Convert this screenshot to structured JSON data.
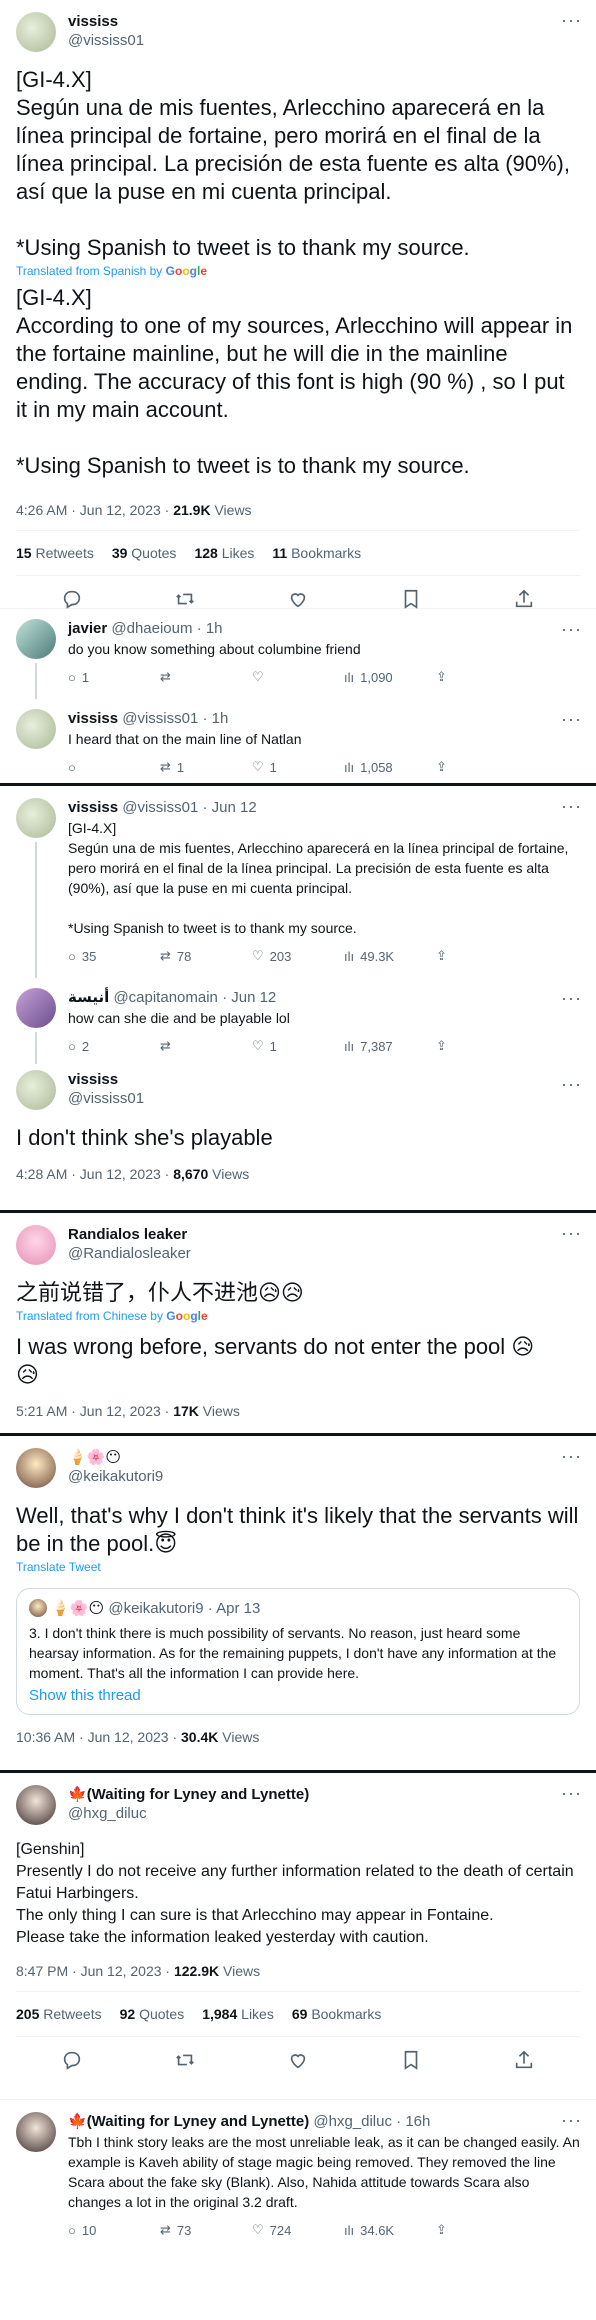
{
  "colors": {
    "accent": "#1d9bf0",
    "text": "#0f1419",
    "muted": "#536471",
    "border": "#eff3f4"
  },
  "t1": {
    "display_name": "vississ",
    "username": "@vississ01",
    "text_es": "[GI-4.X]\nSegún una de mis fuentes, Arlecchino aparecerá en la línea principal de fortaine, pero morirá en el final de la línea principal. La precisión de esta fuente es alta (90%), así que la puse en mi cuenta principal.\n\n*Using Spanish to tweet is to thank my source.",
    "translated_prefix": "Translated from Spanish by",
    "text_en": "[GI-4.X]\nAccording to one of my sources, Arlecchino will appear in the fortaine mainline, but he will die in the mainline ending. The accuracy of this font is high (90 %) , so I put it in my main account.\n\n*Using Spanish to tweet is to thank my source.",
    "time": "4:26 AM · Jun 12, 2023 ·",
    "views_num": "21.9K",
    "views_label": "Views",
    "retweets_num": "15",
    "retweets_label": "Retweets",
    "quotes_num": "39",
    "quotes_label": "Quotes",
    "likes_num": "128",
    "likes_label": "Likes",
    "bookmarks_num": "11",
    "bookmarks_label": "Bookmarks"
  },
  "r1": {
    "display_name": "javier",
    "username": "@dhaeioum",
    "time": "· 1h",
    "text": "do you know something about columbine friend",
    "replies": "1",
    "retweets": "",
    "likes": "",
    "views": "1,090"
  },
  "r2": {
    "display_name": "vississ",
    "username": "@vississ01",
    "time": "· 1h",
    "text": "I heard that on the main line of Natlan",
    "replies": "",
    "retweets": "1",
    "likes": "1",
    "views": "1,058"
  },
  "t2": {
    "display_name": "vississ",
    "username": "@vississ01",
    "time": "· Jun 12",
    "text": "[GI-4.X]\nSegún una de mis fuentes, Arlecchino aparecerá en la línea principal de fortaine, pero morirá en el final de la línea principal. La precisión de esta fuente es alta (90%), así que la puse en mi cuenta principal.\n\n*Using Spanish to tweet is to thank my source.",
    "replies": "35",
    "retweets": "78",
    "likes": "203",
    "views": "49.3K"
  },
  "t3": {
    "display_name": "أنيسة",
    "username": "@capitanomain",
    "time": "· Jun 12",
    "text": "how can she die and be playable lol",
    "replies": "2",
    "retweets": "",
    "likes": "1",
    "views": "7,387"
  },
  "t4": {
    "display_name": "vississ",
    "username": "@vississ01",
    "text": "I don't think she's playable",
    "time": "4:28 AM · Jun 12, 2023 ·",
    "views_num": "8,670",
    "views_label": "Views"
  },
  "t5": {
    "display_name": "Randialos leaker",
    "username": "@Randialosleaker",
    "text_zh": "之前说错了，仆人不进池😥😥",
    "translated_prefix": "Translated from Chinese by",
    "text_en": "I was wrong before, servants do not enter the pool 😥\n😥",
    "time": "5:21 AM · Jun 12, 2023 ·",
    "views_num": "17K",
    "views_label": "Views"
  },
  "t6": {
    "display_name": "🍦🌸😶",
    "username": "@keikakutori9",
    "text": "Well, that's why I don't think it's likely that the servants will be in the pool.😇",
    "translate": "Translate Tweet",
    "quote_name": "🍦🌸😶",
    "quote_user": "@keikakutori9 · Apr 13",
    "quote_text": "3. I don't think there is much possibility of servants. No reason, just heard some hearsay information. As for the remaining puppets, I don't have any information at the moment. That's all the information I can provide here.",
    "quote_link": "Show this thread",
    "time": "10:36 AM · Jun 12, 2023 ·",
    "views_num": "30.4K",
    "views_label": "Views"
  },
  "t7": {
    "flag": "🍁",
    "display_name": "(Waiting for Lyney and Lynette)",
    "username": "@hxg_diluc",
    "text": "[Genshin]\nPresently I do not receive any further information related to the death of certain Fatui Harbingers.\nThe only thing I can sure is that Arlecchino may appear in Fontaine.\nPlease take the information leaked yesterday with caution.",
    "time": "8:47 PM · Jun 12, 2023 ·",
    "views_num": "122.9K",
    "views_label": "Views",
    "retweets_num": "205",
    "retweets_label": "Retweets",
    "quotes_num": "92",
    "quotes_label": "Quotes",
    "likes_num": "1,984",
    "likes_label": "Likes",
    "bookmarks_num": "69",
    "bookmarks_label": "Bookmarks"
  },
  "t8": {
    "flag": "🍁",
    "display_name": "(Waiting for Lyney and Lynette)",
    "username": "@hxg_diluc",
    "time": "· 16h",
    "text": "Tbh I think story leaks are the most unreliable leak, as it can be changed easily. An example is Kaveh ability of stage magic being removed. They removed the line Scara about the fake sky (Blank). Also, Nahida attitude towards Scara also changes a lot in the original 3.2 draft.",
    "replies": "10",
    "retweets": "73",
    "likes": "724",
    "views": "34.6K"
  },
  "google": {
    "g1": "G",
    "g2": "o",
    "g3": "o",
    "g4": "g",
    "g5": "l",
    "g6": "e"
  },
  "icons": [
    "reply-icon",
    "retweet-icon",
    "like-icon",
    "bookmark-icon",
    "share-icon",
    "views-icon",
    "more-icon"
  ]
}
